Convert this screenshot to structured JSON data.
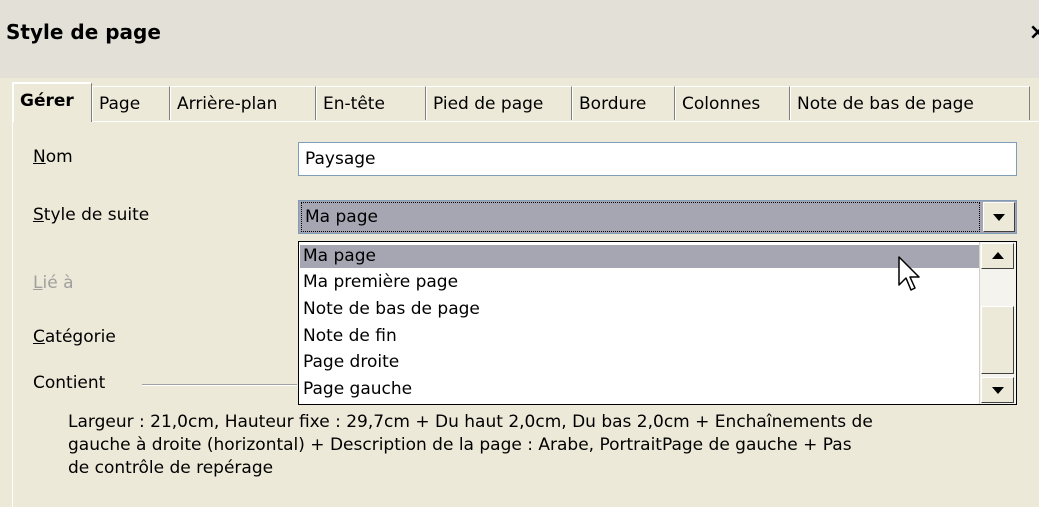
{
  "window": {
    "title": "Style de page",
    "close_glyph": "×"
  },
  "tabs": [
    {
      "label": "Gérer",
      "active": true
    },
    {
      "label": "Page"
    },
    {
      "label": "Arrière-plan"
    },
    {
      "label": "En-tête"
    },
    {
      "label": "Pied de page"
    },
    {
      "label": "Bordure"
    },
    {
      "label": "Colonnes"
    },
    {
      "label": "Note de bas de page"
    }
  ],
  "form": {
    "nom": {
      "label_ul": "N",
      "label_rest": "om",
      "value": "Paysage"
    },
    "style_suite": {
      "label_ul": "S",
      "label_rest": "tyle de suite",
      "value": "Ma page"
    },
    "lie_a": {
      "label_ul": "L",
      "label_rest": "ié à"
    },
    "categorie": {
      "label_ul": "C",
      "label_rest": "atégorie"
    },
    "contient": {
      "label": "Contient"
    }
  },
  "dropdown": {
    "items": [
      {
        "label": "Ma page",
        "selected": true
      },
      {
        "label": "Ma première page"
      },
      {
        "label": "Note de bas de page"
      },
      {
        "label": "Note de fin"
      },
      {
        "label": "Page droite"
      },
      {
        "label": "Page gauche"
      }
    ]
  },
  "description": {
    "line1": "Largeur : 21,0cm, Hauteur fixe : 29,7cm + Du haut 2,0cm, Du bas 2,0cm + Enchaînements de",
    "line2": "gauche à droite (horizontal) + Description de la page : Arabe, PortraitPage de gauche + Pas",
    "line3": "de contrôle de repérage"
  },
  "icons": {
    "cursor": "mouse-pointer-icon",
    "close": "close-icon"
  }
}
